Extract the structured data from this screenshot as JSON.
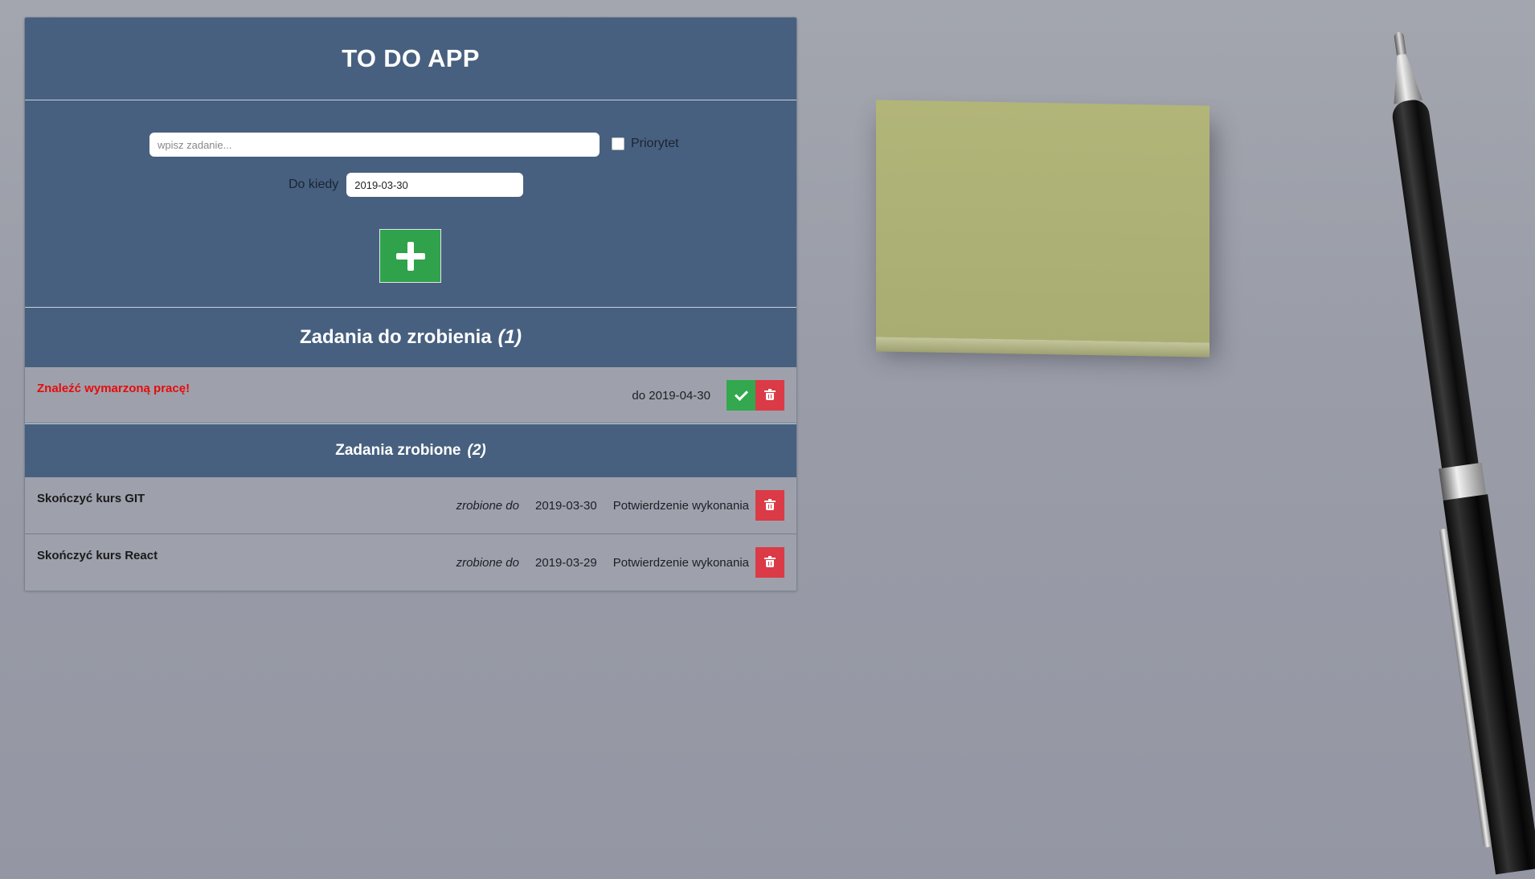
{
  "app": {
    "title": "TO DO APP"
  },
  "form": {
    "task_placeholder": "wpisz zadanie...",
    "task_value": "",
    "priority_label": "Priorytet",
    "priority_checked": false,
    "date_label": "Do kiedy",
    "date_value": "2019-03-30",
    "add_button_icon": "plus-icon"
  },
  "todo": {
    "title": "Zadania do zrobienia",
    "count": "(1)",
    "items": [
      {
        "name": "Znaleźć wymarzoną pracę!",
        "priority": true,
        "deadline": "do 2019-04-30",
        "complete_icon": "check-icon",
        "delete_icon": "trash-icon"
      }
    ]
  },
  "done": {
    "title": "Zadania zrobione",
    "count": "(2)",
    "items": [
      {
        "name": "Skończyć kurs GIT",
        "due_label": "zrobione do",
        "due_date": "2019-03-30",
        "confirm_label": "Potwierdzenie wykonania",
        "delete_icon": "trash-icon"
      },
      {
        "name": "Skończyć kurs React",
        "due_label": "zrobione do",
        "due_date": "2019-03-29",
        "confirm_label": "Potwierdzenie wykonania",
        "delete_icon": "trash-icon"
      }
    ]
  },
  "colors": {
    "panel_blue": "#47607f",
    "row_gray": "#9ea1ab",
    "add_green": "#2fa24b",
    "priority_red": "#e60c0c",
    "delete_red": "#db3a47"
  }
}
